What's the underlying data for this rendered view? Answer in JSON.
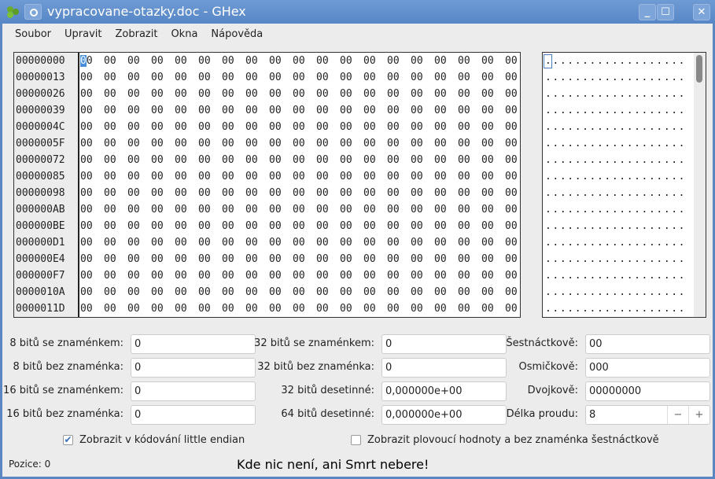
{
  "window": {
    "title": "vypracovane-otazky.doc - GHex",
    "minimize": "_",
    "maximize": "☐",
    "close": "✕"
  },
  "menu": [
    "Soubor",
    "Upravit",
    "Zobrazit",
    "Okna",
    "Nápověda"
  ],
  "hex": {
    "offsets": [
      "00000000",
      "00000013",
      "00000026",
      "00000039",
      "0000004C",
      "0000005F",
      "00000072",
      "00000085",
      "00000098",
      "000000AB",
      "000000BE",
      "000000D1",
      "000000E4",
      "000000F7",
      "0000010A",
      "0000011D"
    ],
    "byte_value": "00",
    "bytes_per_row": 19,
    "ascii_char": ".",
    "cursor_byte": 0
  },
  "fields": [
    {
      "label": "8 bitů se znaménkem:",
      "value": "0"
    },
    {
      "label": "8 bitů bez znaménka:",
      "value": "0"
    },
    {
      "label": "16 bitů se znaménkem:",
      "value": "0"
    },
    {
      "label": "16 bitů bez znaménka:",
      "value": "0"
    },
    {
      "label": "32 bitů se znaménkem:",
      "value": "0"
    },
    {
      "label": "32 bitů bez znaménka:",
      "value": "0"
    },
    {
      "label": "32 bitů desetinné:",
      "value": "0,000000e+00"
    },
    {
      "label": "64 bitů desetinné:",
      "value": "0,000000e+00"
    },
    {
      "label": "Šestnáctkově:",
      "value": "00"
    },
    {
      "label": "Osmičkově:",
      "value": "000"
    },
    {
      "label": "Dvojkově:",
      "value": "00000000"
    },
    {
      "label": "Délka proudu:",
      "value": "8"
    }
  ],
  "spin": {
    "minus": "−",
    "plus": "+"
  },
  "checks": [
    {
      "label": "Zobrazit v kódování little endian",
      "checked": true,
      "mark": "✔"
    },
    {
      "label": "Zobrazit plovoucí hodnoty a bez znaménka šestnáctkově",
      "checked": false
    }
  ],
  "status": {
    "position": "Pozice: 0",
    "message": "Kde nic není, ani Smrt nebere!"
  }
}
